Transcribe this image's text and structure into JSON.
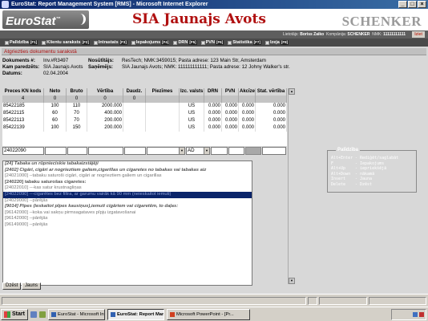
{
  "window": {
    "title": "EuroStat: Report Management System [RMS] - Microsoft Internet Explorer",
    "buttons": [
      "_",
      "□",
      "×"
    ]
  },
  "header": {
    "logo": "EuroStat",
    "logo_tm": "™",
    "company": "SIA Jaunajs Avots",
    "brand": "SCHENKER"
  },
  "userbar": {
    "user_label": "Lietotājs:",
    "user": "Boriss Zaiko",
    "company_label": "Kompānija:",
    "company": "SCHENKER",
    "nmk_label": "NMK:",
    "nmk": "11111111111",
    "exit": "Iziet"
  },
  "menu": [
    {
      "label": "Palīdzība",
      "key": "F1"
    },
    {
      "label": "Klientu saraksts",
      "key": "F2"
    },
    {
      "label": "Intrastats",
      "key": "F3"
    },
    {
      "label": "Iepakojums",
      "key": "F4"
    },
    {
      "label": "DRN",
      "key": "F5"
    },
    {
      "label": "PVN",
      "key": "F6"
    },
    {
      "label": "Statistika",
      "key": "F7"
    },
    {
      "label": "Izeja",
      "key": "F8"
    }
  ],
  "section_title": "Atgriezties dokumentu sarakstā",
  "document": {
    "number_label": "Dokuments #:",
    "number": "Inv.#R3497",
    "sender_label": "Nosūtītājs:",
    "sender": "ResTech; NMK:3459015; Pasta adrese: 123 Main Str, Amsterdam",
    "from_label": "Kam paredzēts:",
    "from": "SIA Jaunajs Avots",
    "receiver_label": "Saņēmējs:",
    "receiver": "SIA Jaunajs Avots; NMK: 111111111111; Pasta adrese: 12 Johny Walker's str.",
    "date_label": "Datums:",
    "date": "02.04.2004"
  },
  "grid": {
    "columns": [
      "Preces KN kods",
      "Neto",
      "Bruto",
      "Vērtība",
      "Daudz.",
      "Piezīmes",
      "Izc. valsts",
      "DRN",
      "PVN",
      "Akcīze",
      "Stat. vērtība"
    ],
    "totals": [
      "4",
      "0",
      "0",
      "0",
      "0",
      "",
      "",
      "",
      "",
      "",
      ""
    ],
    "rows": [
      [
        "85422185",
        "100",
        "110",
        "2000.000",
        "",
        "",
        "US",
        "0.000",
        "0.000",
        "0.000",
        "0.000"
      ],
      [
        "85422115",
        "60",
        "70",
        "400.000",
        "",
        "",
        "US",
        "0.000",
        "0.000",
        "0.000",
        "0.000"
      ],
      [
        "85422113",
        "60",
        "70",
        "200.000",
        "",
        "",
        "US",
        "0.000",
        "0.000",
        "0.000",
        "0.000"
      ],
      [
        "85422139",
        "100",
        "150",
        "200.000",
        "",
        "",
        "US",
        "0.000",
        "0.000",
        "0.000",
        "0.000"
      ]
    ],
    "input": {
      "code": "24022090",
      "country": "AD"
    }
  },
  "dropdown": {
    "items": [
      {
        "text": "[24] Tabaka un rūpnieciskie tabakaizstājēji",
        "style": "bold"
      },
      {
        "text": "[2402] Cigāri, cigāri ar nogrieztiem galiem,cigarillas un cigaretes no tabakas vai tabakas aiz",
        "style": "bold"
      },
      {
        "text": "[24021000] --tabaku saturoši cigāri, cigāri ar nogrieztiem galiem un cigarillas",
        "style": "normal"
      },
      {
        "text": "[240220] tabaku saturošas cigaretes:",
        "style": "sub"
      },
      {
        "text": "[24022010] ---kas satur krustnagliņas",
        "style": "normal"
      },
      {
        "text": "[24022090] ---cigarētes bez filtra, ar garumu vairāk kā 90 mm (neieskaitot iemuti)",
        "style": "selected"
      },
      {
        "text": "[24029000] --pārējās",
        "style": "normal"
      },
      {
        "text": "[9014] Pīpes (ieskaitot pīpes kausiņus),iemuti cigāriem vai cigaretēm, to daļas:",
        "style": "bold"
      },
      {
        "text": "[96142000] --koka vai sakņu pirmsagataves pīpju izgatavošanai",
        "style": "normal"
      },
      {
        "text": "[96142000] --pārējās",
        "style": "normal"
      },
      {
        "text": "[96149000] --pārējās",
        "style": "normal"
      }
    ]
  },
  "help": {
    "title": "Palīdzība",
    "lines": [
      {
        "key": "Alt+Enter",
        "desc": "- Rediģēt/saglabāt"
      },
      {
        "key": "F",
        "desc": "- Iepakojums"
      },
      {
        "key": "Alt+Up",
        "desc": "- iepriekšējā"
      },
      {
        "key": "Alt+Down",
        "desc": "- nākamā"
      },
      {
        "key": "Insert",
        "desc": "- Jauna"
      },
      {
        "key": "Delete",
        "desc": "- Dzēst"
      }
    ]
  },
  "buttons": {
    "delete": "Dzēst",
    "new": "Jauns"
  },
  "taskbar": {
    "start": "Start",
    "tasks": [
      {
        "label": "EuroStat - Microsoft Intern...",
        "active": false
      },
      {
        "label": "EuroStat: Report Man...",
        "active": true
      },
      {
        "label": "Microsoft PowerPoint - [Pr...",
        "active": false
      }
    ]
  }
}
